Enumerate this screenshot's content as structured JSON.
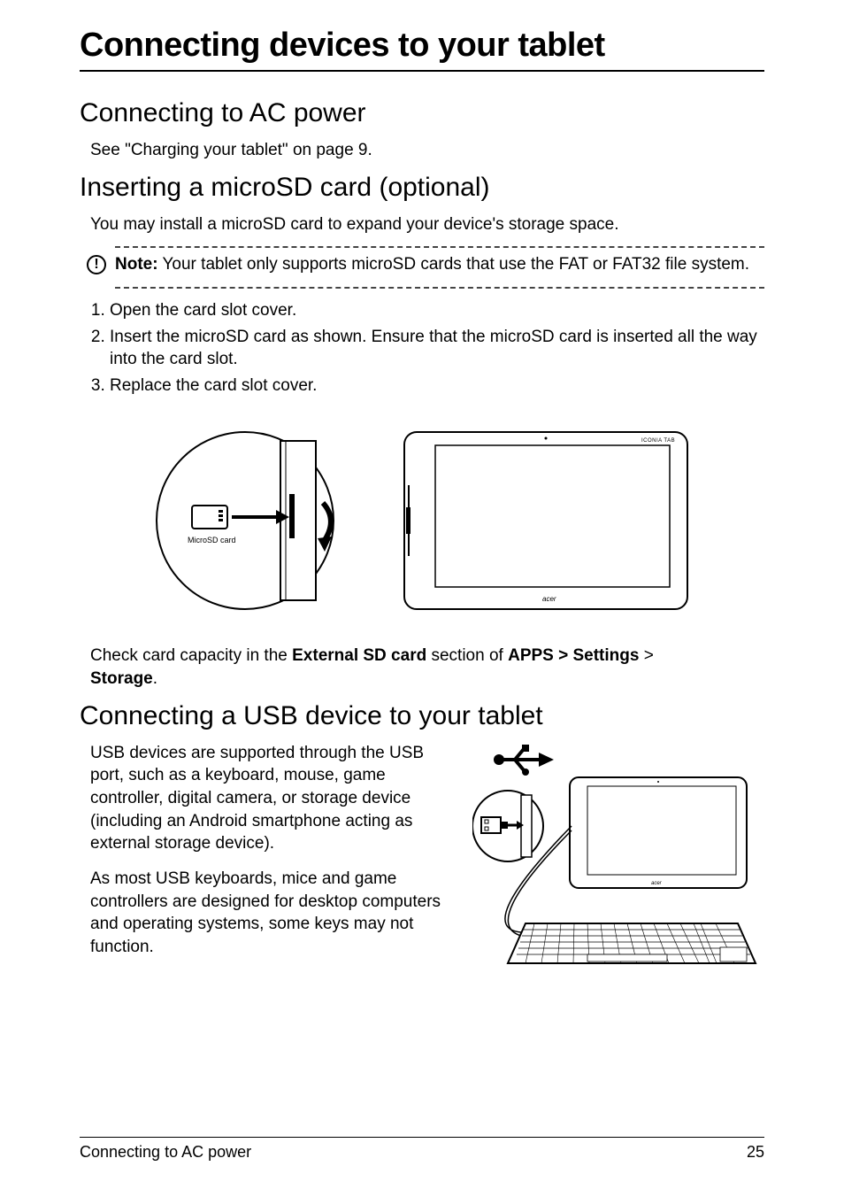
{
  "title": "Connecting devices to your tablet",
  "section1": {
    "heading": "Connecting to AC power",
    "paragraph": "See \"Charging your tablet\" on page 9."
  },
  "section2": {
    "heading": "Inserting a microSD card (optional)",
    "paragraph": "You may install a microSD card to expand your device's storage space.",
    "note_label": "Note:",
    "note_text": " Your tablet only supports microSD cards that use the FAT or FAT32 file system.",
    "steps": [
      "Open the card slot cover.",
      "Insert the microSD card as shown. Ensure that the microSD card is inserted all the way into the card slot.",
      "Replace the card slot cover."
    ],
    "figure_sd_label": "MicroSD card",
    "check_prefix": "Check card capacity in the ",
    "check_bold1": "External SD card",
    "check_mid": " section of ",
    "check_bold2": "APPS > Settings",
    "check_gt": " > ",
    "check_bold3": "Storage",
    "check_suffix": "."
  },
  "section3": {
    "heading": "Connecting a USB device to your tablet",
    "p1": "USB devices are supported through the USB port, such as a keyboard, mouse, game controller, digital camera, or storage device (including an Android smartphone acting as external storage device).",
    "p2": "As most USB keyboards, mice and game controllers are designed for desktop computers and operating systems, some keys may not function."
  },
  "footer": {
    "left": "Connecting to AC power",
    "right": "25"
  },
  "tablet_brand": "acer",
  "tablet_model": "ICONIA TAB"
}
